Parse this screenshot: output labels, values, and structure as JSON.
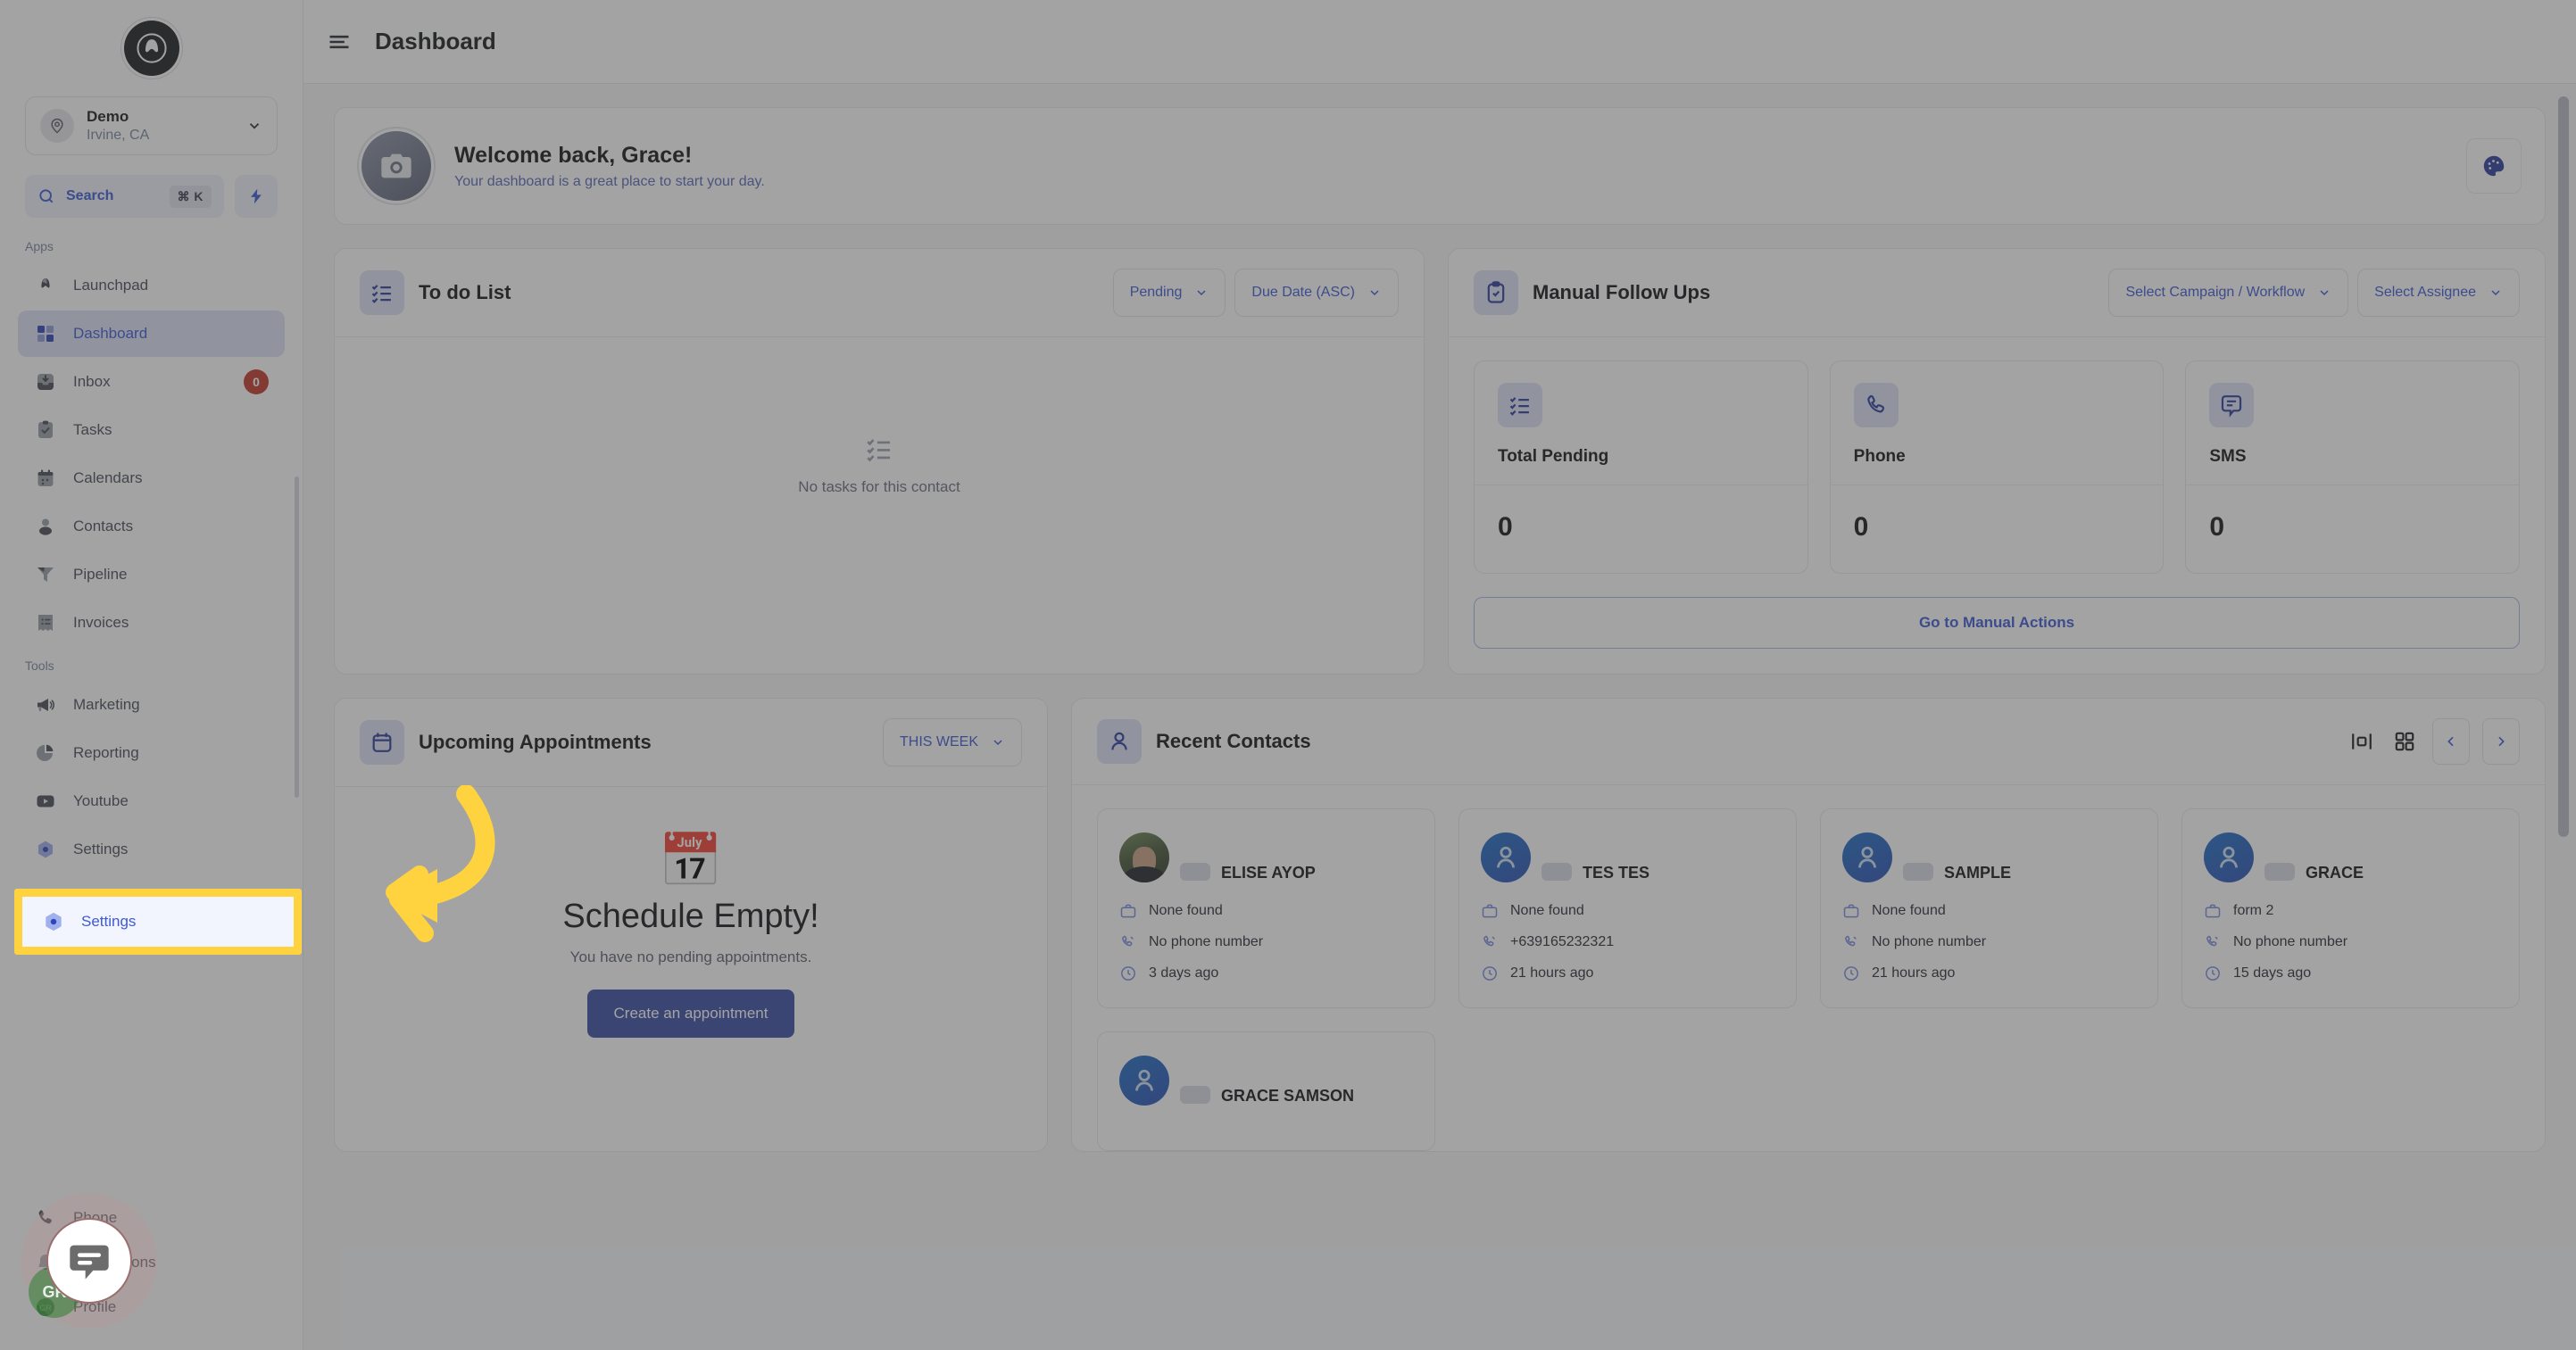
{
  "brand": {
    "logo_letter": "A",
    "accent": "#3d5ad4",
    "highlight": "#ffd23f"
  },
  "sidebar": {
    "location": {
      "name": "Demo",
      "sub": "Irvine, CA"
    },
    "search": {
      "label": "Search",
      "shortcut": "⌘ K"
    },
    "groups": [
      {
        "label": "Apps",
        "items": [
          {
            "label": "Launchpad",
            "icon": "launchpad-icon",
            "active": false,
            "badge": null
          },
          {
            "label": "Dashboard",
            "icon": "dashboard-icon",
            "active": true,
            "badge": null
          },
          {
            "label": "Inbox",
            "icon": "inbox-icon",
            "active": false,
            "badge": "0"
          },
          {
            "label": "Tasks",
            "icon": "tasks-icon",
            "active": false,
            "badge": null
          },
          {
            "label": "Calendars",
            "icon": "calendar-icon",
            "active": false,
            "badge": null
          },
          {
            "label": "Contacts",
            "icon": "contacts-icon",
            "active": false,
            "badge": null
          },
          {
            "label": "Pipeline",
            "icon": "pipeline-icon",
            "active": false,
            "badge": null
          },
          {
            "label": "Invoices",
            "icon": "invoices-icon",
            "active": false,
            "badge": null
          }
        ]
      },
      {
        "label": "Tools",
        "items": [
          {
            "label": "Marketing",
            "icon": "megaphone-icon",
            "active": false,
            "badge": null
          },
          {
            "label": "Reporting",
            "icon": "pie-chart-icon",
            "active": false,
            "badge": null
          },
          {
            "label": "Youtube",
            "icon": "youtube-icon",
            "active": false,
            "badge": null
          },
          {
            "label": "Settings",
            "icon": "settings-icon",
            "active": false,
            "badge": null
          }
        ]
      }
    ],
    "bottom": [
      {
        "label": "Phone",
        "icon": "phone-icon"
      },
      {
        "label": "Notifications",
        "icon": "bell-icon"
      },
      {
        "label": "Profile",
        "icon": "profile-icon"
      }
    ]
  },
  "topbar": {
    "title": "Dashboard",
    "menu_icon": "hamburger-icon"
  },
  "welcome": {
    "title": "Welcome back, Grace!",
    "subtitle": "Your dashboard is a great place to start your day.",
    "avatar_icon": "camera-icon",
    "theme_button_icon": "palette-icon"
  },
  "todo": {
    "title": "To do List",
    "icon": "checklist-icon",
    "filters": [
      {
        "label": "Pending",
        "name": "status-filter"
      },
      {
        "label": "Due Date (ASC)",
        "name": "sort-filter"
      }
    ],
    "empty_text": "No tasks for this contact"
  },
  "follow_ups": {
    "title": "Manual Follow Ups",
    "icon": "clipboard-check-icon",
    "filters": [
      {
        "label": "Select Campaign / Workflow",
        "name": "campaign-filter"
      },
      {
        "label": "Select Assignee",
        "name": "assignee-filter"
      }
    ],
    "stats": [
      {
        "label": "Total Pending",
        "value": "0",
        "icon": "checklist-icon"
      },
      {
        "label": "Phone",
        "value": "0",
        "icon": "phone-icon"
      },
      {
        "label": "SMS",
        "value": "0",
        "icon": "sms-icon"
      }
    ],
    "cta": "Go to Manual Actions"
  },
  "appointments": {
    "title": "Upcoming Appointments",
    "icon": "calendar-icon",
    "range_filter": "THIS WEEK",
    "empty_title": "Schedule Empty!",
    "empty_sub": "You have no pending appointments.",
    "cta": "Create an appointment",
    "empty_icon": "calendar-glyph"
  },
  "recent_contacts": {
    "title": "Recent Contacts",
    "icon": "user-icon",
    "view_toggles": [
      {
        "name": "list-view-icon"
      },
      {
        "name": "grid-view-icon"
      }
    ],
    "pager": [
      {
        "name": "prev-page-button",
        "glyph": "‹"
      },
      {
        "name": "next-page-button",
        "glyph": "›"
      }
    ],
    "rows": [
      [
        {
          "name": "ELISE AYOP",
          "company": "None found",
          "phone": "No phone number",
          "time": "3 days ago",
          "avatar": "photo"
        },
        {
          "name": "TES TES",
          "company": "None found",
          "phone": "+639165232321",
          "time": "21 hours ago",
          "avatar": "initials"
        },
        {
          "name": "SAMPLE",
          "company": "None found",
          "phone": "No phone number",
          "time": "21 hours ago",
          "avatar": "initials"
        },
        {
          "name": "GRACE",
          "company": "form 2",
          "phone": "No phone number",
          "time": "15 days ago",
          "avatar": "initials"
        }
      ],
      [
        {
          "name": "GRACE SAMSON",
          "company": "",
          "phone": "",
          "time": "",
          "avatar": "initials"
        }
      ]
    ]
  },
  "annotation": {
    "highlight_label": "Settings",
    "highlight_icon": "settings-icon",
    "arrow_name": "yellow-curved-arrow"
  },
  "chat_widget": {
    "icon": "chat-bubble-icon",
    "avatar_initials": "GR"
  }
}
